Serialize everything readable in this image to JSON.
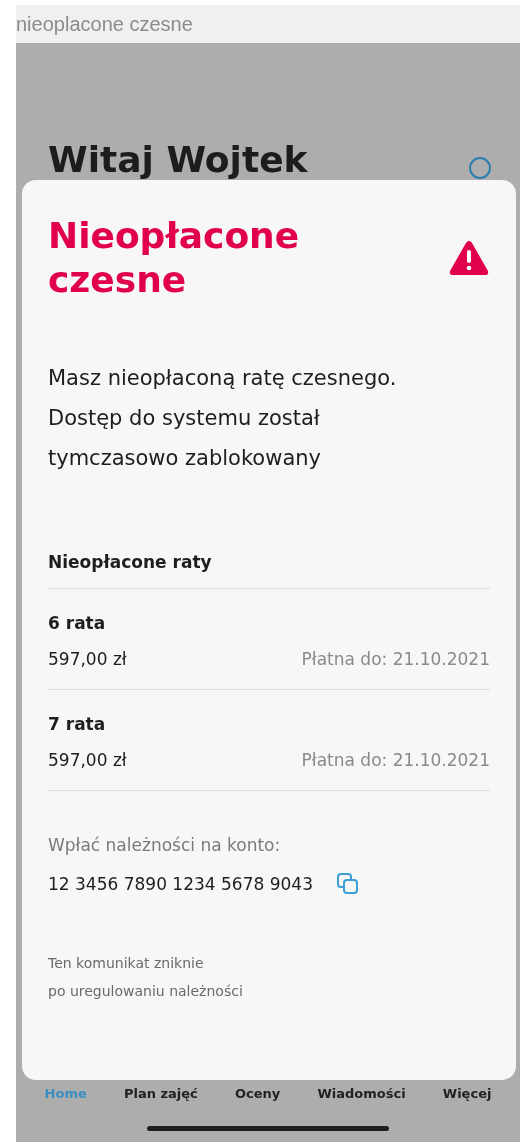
{
  "window": {
    "title": "nieoplacone czesne"
  },
  "greeting": "Witaj Wojtek",
  "modal": {
    "title": "Nieopłacone czesne",
    "message": "Masz nieopłaconą ratę czesnego. Dostęp do systemu został tymczasowo zablokowany",
    "section_title": "Nieopłacone raty",
    "installments": [
      {
        "name": "6 rata",
        "amount": "597,00 zł",
        "due": "Płatna do: 21.10.2021"
      },
      {
        "name": "7 rata",
        "amount": "597,00 zł",
        "due": "Płatna do: 21.10.2021"
      }
    ],
    "account_label": "Wpłać należności na konto:",
    "account_number": "12 3456 7890 1234 5678 9043",
    "footer": [
      "Ten komunikat zniknie",
      "po uregulowaniu należności"
    ]
  },
  "tabs": [
    {
      "label": "Home",
      "selected": true
    },
    {
      "label": "Plan zajęć",
      "selected": false
    },
    {
      "label": "Oceny",
      "selected": false
    },
    {
      "label": "Wiadomości",
      "selected": false
    },
    {
      "label": "Więcej",
      "selected": false
    }
  ]
}
